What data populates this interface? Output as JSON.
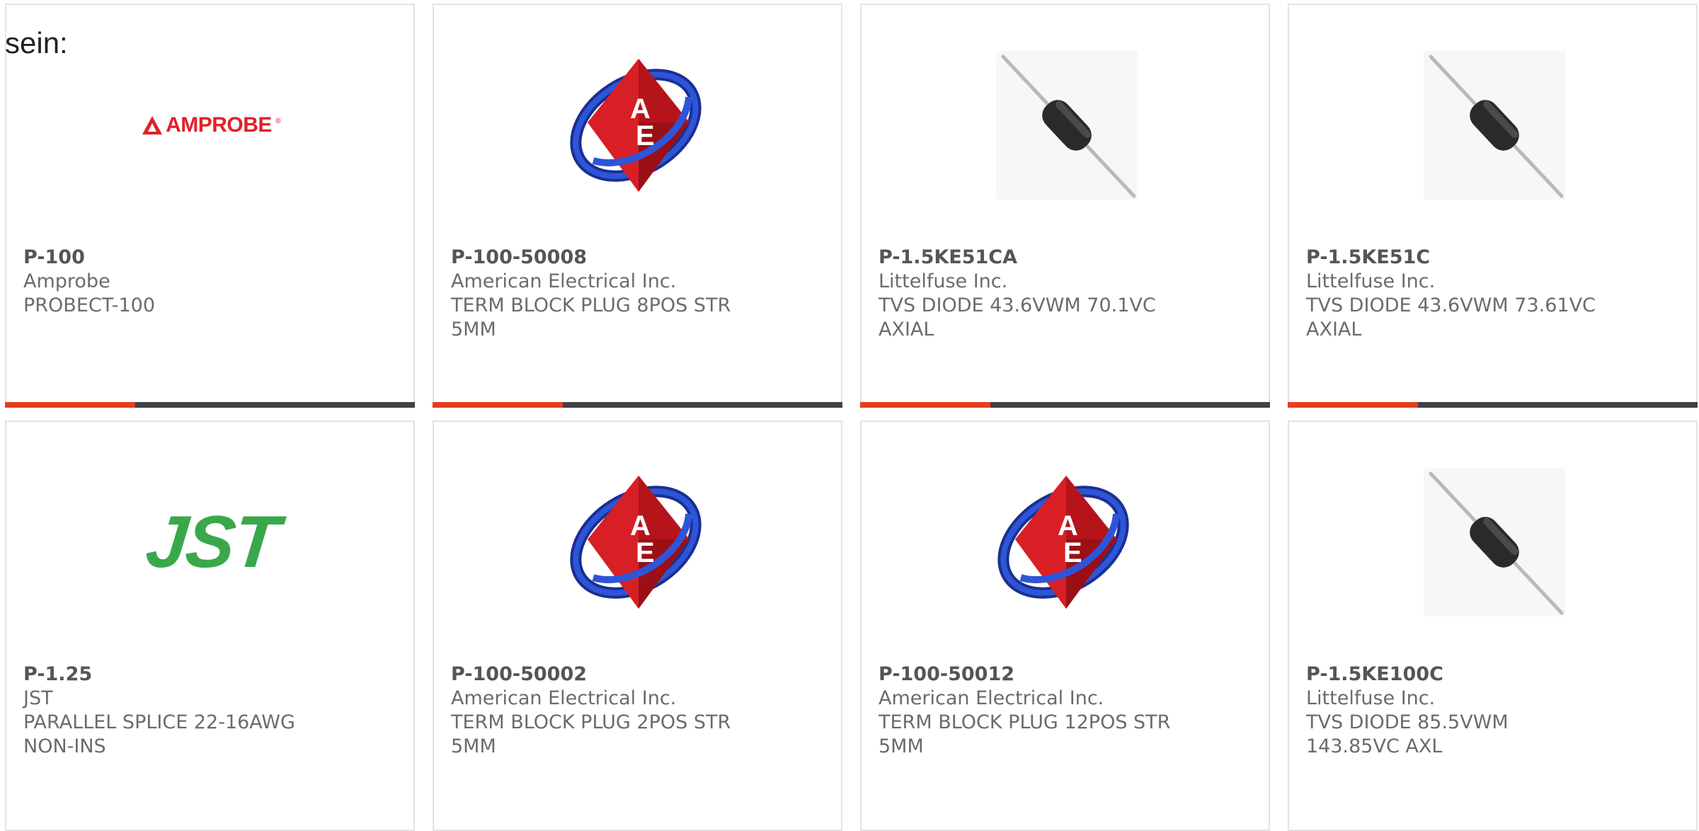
{
  "intro_text": "sein:",
  "colors": {
    "accent_bar": "#e63e1c",
    "dark_bar": "#3f4243",
    "amprobe_red": "#e2202a",
    "jst_green": "#3aa84a",
    "ae_red": "#d81f26",
    "ae_blue": "#1f3fbf"
  },
  "products": [
    {
      "part": "P-100",
      "maker": "Amprobe",
      "desc": "PROBECT-100",
      "logo": "amprobe-logo",
      "logo_text": "AMPROBE",
      "logo_mark": "®"
    },
    {
      "part": "P-100-50008",
      "maker": "American Electrical Inc.",
      "desc": "TERM BLOCK PLUG 8POS STR 5MM",
      "logo": "american-electrical-logo"
    },
    {
      "part": "P-1.5KE51CA",
      "maker": "Littelfuse Inc.",
      "desc": "TVS DIODE 43.6VWM 70.1VC AXIAL",
      "logo": "axial-diode-image"
    },
    {
      "part": "P-1.5KE51C",
      "maker": "Littelfuse Inc.",
      "desc": "TVS DIODE 43.6VWM 73.61VC AXIAL",
      "logo": "axial-diode-image"
    },
    {
      "part": "P-1.25",
      "maker": "JST",
      "desc": "PARALLEL SPLICE 22-16AWG NON-INS",
      "logo": "jst-logo",
      "logo_text": "JST"
    },
    {
      "part": "P-100-50002",
      "maker": "American Electrical Inc.",
      "desc": "TERM BLOCK PLUG 2POS STR 5MM",
      "logo": "american-electrical-logo"
    },
    {
      "part": "P-100-50012",
      "maker": "American Electrical Inc.",
      "desc": "TERM BLOCK PLUG 12POS STR 5MM",
      "logo": "american-electrical-logo"
    },
    {
      "part": "P-1.5KE100C",
      "maker": "Littelfuse Inc.",
      "desc": "TVS DIODE 85.5VWM 143.85VC AXL",
      "logo": "axial-diode-image"
    }
  ]
}
